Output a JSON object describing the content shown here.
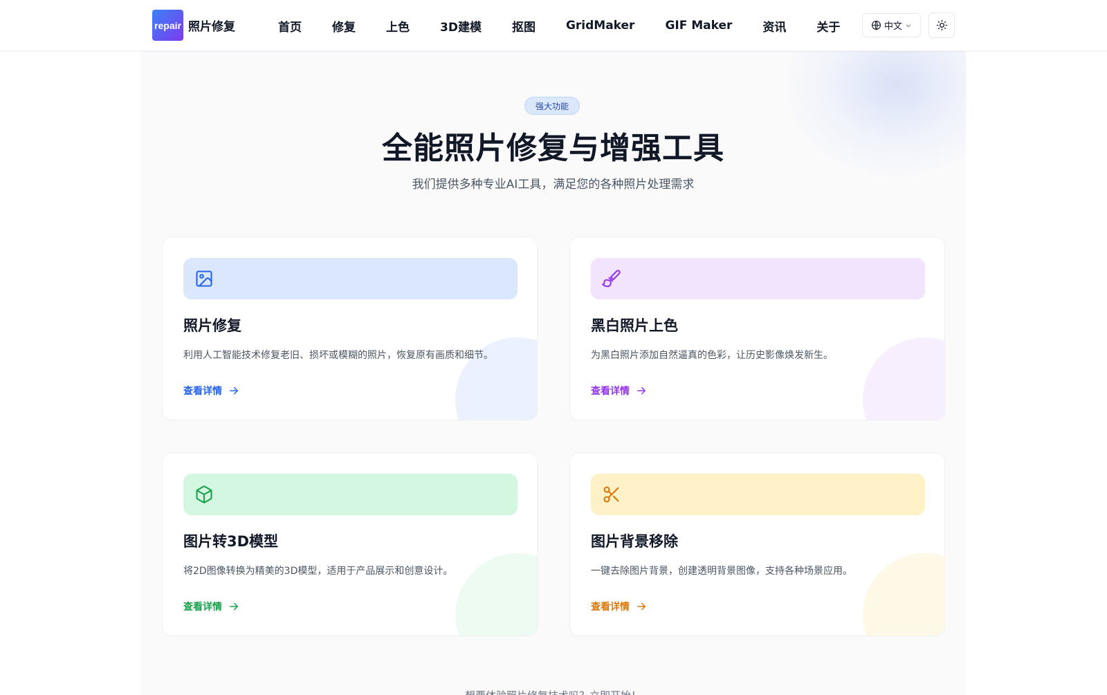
{
  "header": {
    "logo_text": "repair",
    "brand": "照片修复",
    "nav": [
      "首页",
      "修复",
      "上色",
      "3D建模",
      "抠图",
      "GridMaker",
      "GIF Maker",
      "资讯",
      "关于"
    ],
    "language": "中文",
    "icons": {
      "language": "globe-icon",
      "dropdown": "chevron-down-icon",
      "theme": "sun-icon"
    }
  },
  "hero": {
    "badge": "强大功能",
    "title": "全能照片修复与增强工具",
    "subtitle": "我们提供多种专业AI工具，满足您的各种照片处理需求"
  },
  "features": [
    {
      "title": "照片修复",
      "description": "利用人工智能技术修复老旧、损坏或模糊的照片，恢复原有画质和细节。",
      "link": "查看详情",
      "icon": "image-icon",
      "accent": "#2563eb",
      "banner": "#dbe7fd",
      "circle": "#ebf1fe"
    },
    {
      "title": "黑白照片上色",
      "description": "为黑白照片添加自然逼真的色彩，让历史影像焕发新生。",
      "link": "查看详情",
      "icon": "paintbrush-icon",
      "accent": "#9333ea",
      "banner": "#f3e4fd",
      "circle": "#f7effd"
    },
    {
      "title": "图片转3D模型",
      "description": "将2D图像转换为精美的3D模型，适用于产品展示和创意设计。",
      "link": "查看详情",
      "icon": "cube-icon",
      "accent": "#16a34a",
      "banner": "#d4f7e2",
      "circle": "#eefbf3"
    },
    {
      "title": "图片背景移除",
      "description": "一键去除图片背景，创建透明背景图像，支持各种场景应用。",
      "link": "查看详情",
      "icon": "scissors-icon",
      "accent": "#d97706",
      "banner": "#fef1c7",
      "circle": "#fef8e6"
    }
  ],
  "footer_peek": "想要体验照片修复技术吗？立即开始！"
}
